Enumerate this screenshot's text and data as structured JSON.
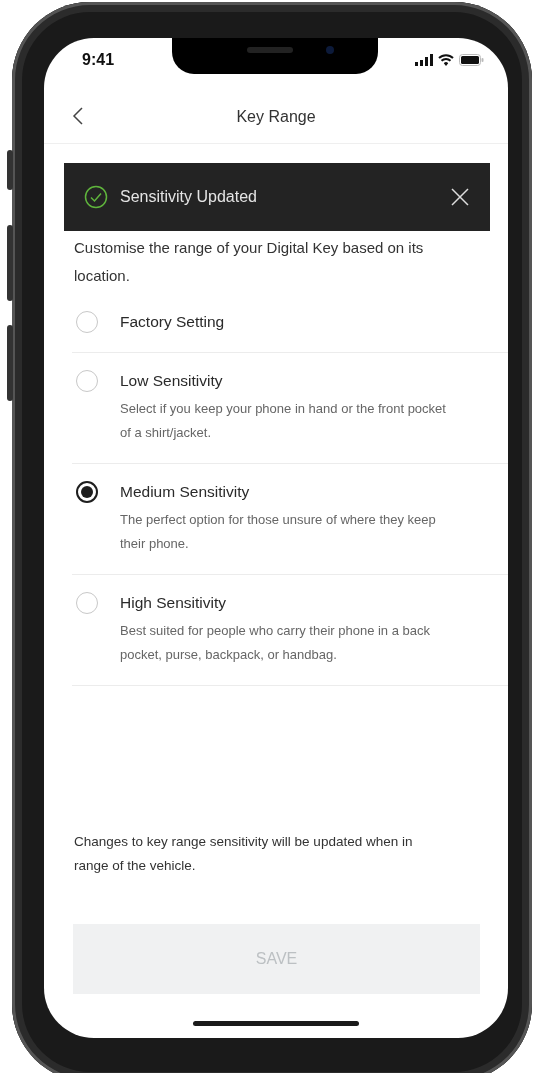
{
  "status_bar": {
    "time": "9:41"
  },
  "header": {
    "title": "Key Range"
  },
  "toast": {
    "message": "Sensitivity Updated"
  },
  "intro": "Customise the range of your Digital Key based on its location.",
  "options": [
    {
      "title": "Factory Setting",
      "selected": false
    },
    {
      "title": "Low Sensitivity",
      "description": "Select if you keep your phone in hand or the front pocket of a shirt/jacket.",
      "selected": false
    },
    {
      "title": "Medium Sensitivity",
      "description": "The perfect option for those unsure of where they keep their phone.",
      "selected": true
    },
    {
      "title": "High Sensitivity",
      "description": "Best suited for people who carry their phone in a back pocket, purse, backpack, or handbag.",
      "selected": false
    }
  ],
  "footer_note": "Changes to key range sensitivity will be updated when in range of the vehicle.",
  "save_button": {
    "label": "SAVE",
    "disabled": true
  }
}
